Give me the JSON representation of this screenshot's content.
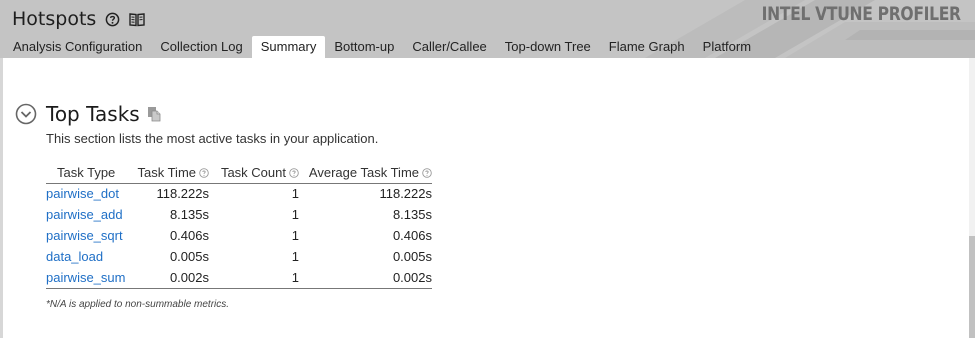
{
  "header": {
    "app_title": "Hotspots",
    "brand": "INTEL VTUNE PROFILER",
    "tabs": [
      {
        "label": "Analysis Configuration",
        "active": false
      },
      {
        "label": "Collection Log",
        "active": false
      },
      {
        "label": "Summary",
        "active": true
      },
      {
        "label": "Bottom-up",
        "active": false
      },
      {
        "label": "Caller/Callee",
        "active": false
      },
      {
        "label": "Top-down Tree",
        "active": false
      },
      {
        "label": "Flame Graph",
        "active": false
      },
      {
        "label": "Platform",
        "active": false
      }
    ]
  },
  "section": {
    "title": "Top Tasks",
    "description": "This section lists the most active tasks in your application."
  },
  "table": {
    "columns": [
      "Task Type",
      "Task Time",
      "Task Count",
      "Average Task Time"
    ],
    "rows": [
      {
        "task_type": "pairwise_dot",
        "task_time": "118.222s",
        "task_count": "1",
        "avg_task_time": "118.222s"
      },
      {
        "task_type": "pairwise_add",
        "task_time": "8.135s",
        "task_count": "1",
        "avg_task_time": "8.135s"
      },
      {
        "task_type": "pairwise_sqrt",
        "task_time": "0.406s",
        "task_count": "1",
        "avg_task_time": "0.406s"
      },
      {
        "task_type": "data_load",
        "task_time": "0.005s",
        "task_count": "1",
        "avg_task_time": "0.005s"
      },
      {
        "task_type": "pairwise_sum",
        "task_time": "0.002s",
        "task_count": "1",
        "avg_task_time": "0.002s"
      }
    ]
  },
  "footnote": "*N/A is applied to non-summable metrics.",
  "colors": {
    "header_bg": "#c4c4c4",
    "link": "#1f6fc6",
    "brand_text": "#6f6f6f"
  },
  "icons": {
    "help": "question-circle-icon",
    "docs": "book-icon",
    "collapse": "chevron-circle-icon",
    "copy": "copy-icon",
    "column_help": "question-circle-icon"
  }
}
